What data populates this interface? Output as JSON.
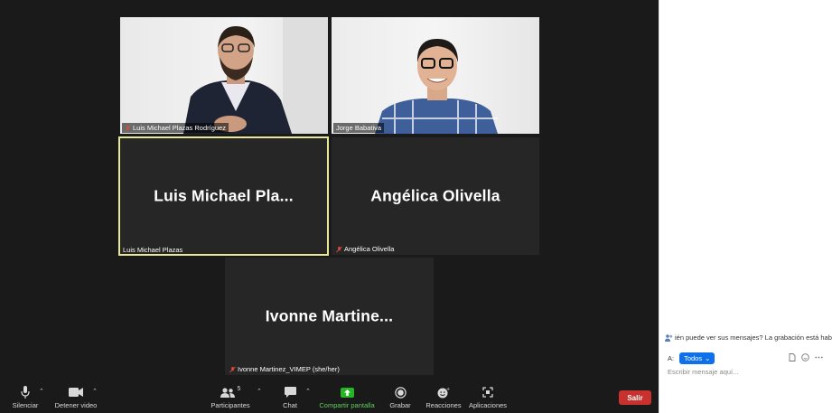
{
  "tiles": [
    {
      "name_label": "Luis Michael Plazas Rodríguez",
      "muted": true
    },
    {
      "name_label": "Jorge Babativa",
      "muted": false
    },
    {
      "display_name": "Luis  Michael  Pla...",
      "name_label": "Luis Michael Plazas",
      "muted": false,
      "active_speaker": true
    },
    {
      "display_name": "Angélica Olivella",
      "name_label": "Angélica Olivella",
      "muted": true
    },
    {
      "display_name": "Ivonne  Martine...",
      "name_label": "Ivonne Martinez_VIMEP (she/her)",
      "muted": true
    }
  ],
  "toolbar": {
    "mute_label": "Silenciar",
    "video_label": "Detener video",
    "participants_label": "Participantes",
    "participants_count": "5",
    "chat_label": "Chat",
    "share_label": "Compartir pantalla",
    "record_label": "Grabar",
    "reactions_label": "Reacciones",
    "apps_label": "Aplicaciones",
    "leave_label": "Salir"
  },
  "chat": {
    "notice": "ién puede ver sus mensajes? La grabación está habilit",
    "to_label": "A:",
    "recipient": "Todos",
    "input_placeholder": "Escribir mensaje aquí..."
  },
  "colors": {
    "meeting_bg": "#1a1a1a",
    "tile_bg": "#262626",
    "active_border": "#e8e89a",
    "share_green": "#5ccf5c",
    "leave_red": "#c8312d",
    "recipient_blue": "#0e71eb"
  }
}
